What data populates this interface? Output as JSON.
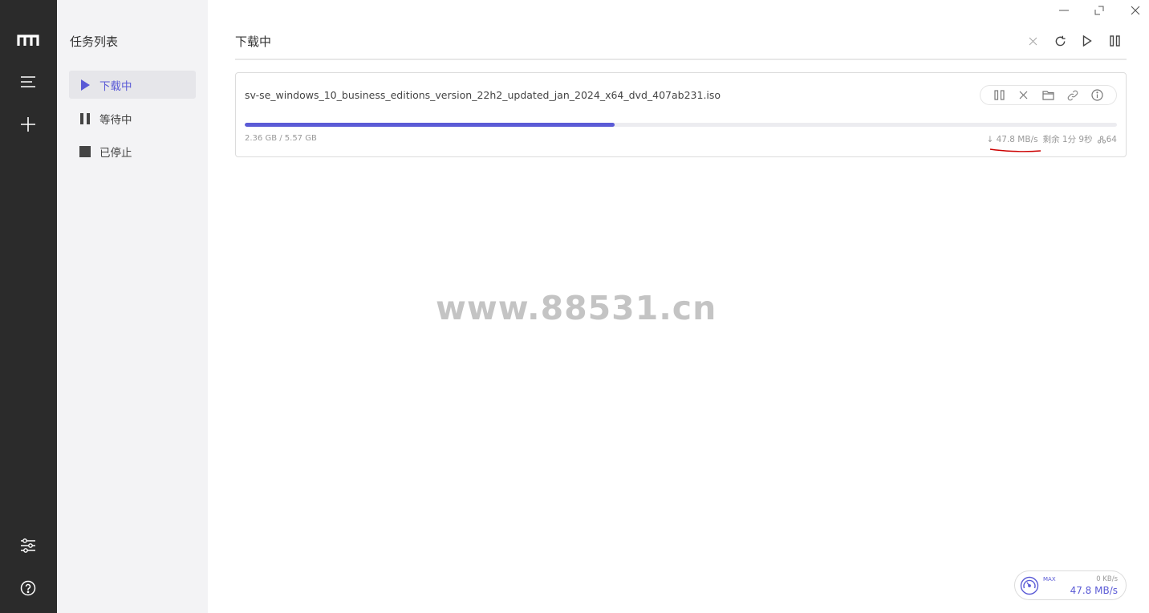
{
  "colors": {
    "accent": "#5b5bd6",
    "rail": "#2b2b2b",
    "sidebar": "#f3f3f5",
    "annotation": "#cc0000"
  },
  "rail": {
    "icons": [
      "logo-m-icon",
      "menu-icon",
      "add-icon",
      "settings-sliders-icon",
      "help-icon"
    ]
  },
  "sidebar": {
    "title": "任务列表",
    "items": [
      {
        "label": "下载中",
        "icon": "play-icon",
        "active": true
      },
      {
        "label": "等待中",
        "icon": "pause-icon",
        "active": false
      },
      {
        "label": "已停止",
        "icon": "stop-icon",
        "active": false
      }
    ]
  },
  "main": {
    "title": "下载中",
    "toolbar_icons": [
      "close-icon",
      "refresh-icon",
      "play-icon",
      "pause-icon"
    ]
  },
  "task": {
    "filename": "sv-se_windows_10_business_editions_version_22h2_updated_jan_2024_x64_dvd_407ab231.iso",
    "size_text": "2.36 GB / 5.57 GB",
    "progress": 0.424,
    "speed": "↓ 47.8 MB/s",
    "remaining": "剩余 1分 9秒",
    "connections": "64",
    "actions": [
      "pause-icon",
      "delete-icon",
      "folder-icon",
      "link-icon",
      "info-icon"
    ]
  },
  "watermark": "www.88531.cn",
  "speedometer": {
    "max_label": "MAX",
    "upload": "0 KB/s",
    "download": "47.8 MB/s"
  }
}
